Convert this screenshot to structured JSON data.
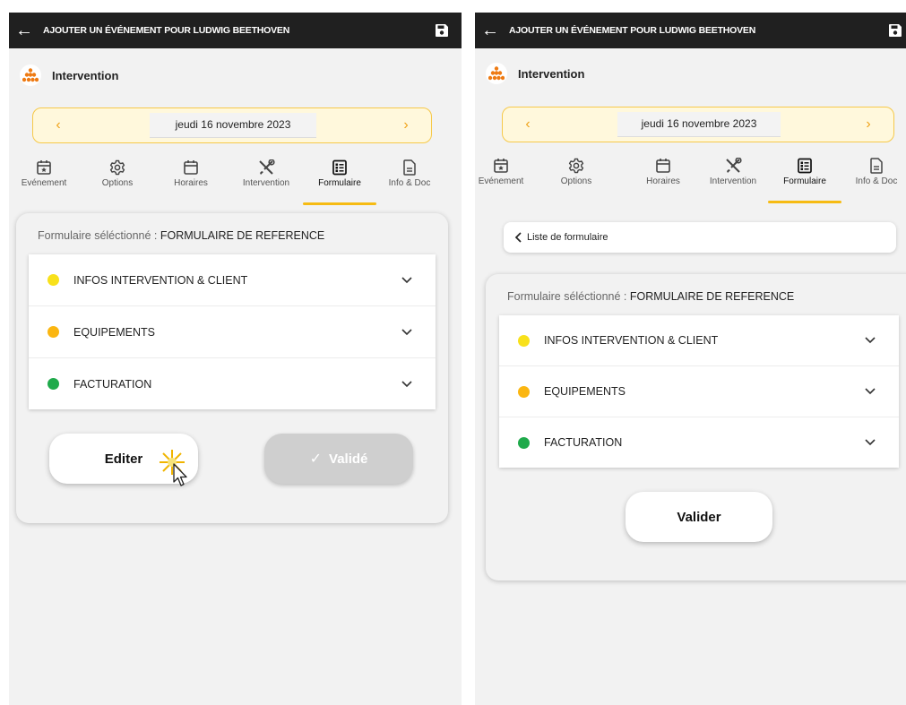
{
  "header": {
    "title": "AJOUTER UN ÉVÉNEMENT POUR LUDWIG BEETHOVEN"
  },
  "section": {
    "label": "Intervention"
  },
  "datebar": {
    "prev": "‹",
    "date": "jeudi 16 novembre 2023",
    "next": "›"
  },
  "tabs": [
    {
      "label": "Evénement",
      "icon": "calendar-star-icon"
    },
    {
      "label": "Options",
      "icon": "gear-icon"
    },
    {
      "label": "Horaires",
      "icon": "calendar-icon"
    },
    {
      "label": "Intervention",
      "icon": "tools-icon"
    },
    {
      "label": "Formulaire",
      "icon": "checklist-icon",
      "active": true
    },
    {
      "label": "Info & Doc",
      "icon": "document-icon"
    }
  ],
  "form": {
    "selected_prefix": "Formulaire séléctionné : ",
    "selected_value": "FORMULAIRE DE REFERENCE",
    "sections": [
      {
        "label": "INFOS INTERVENTION & CLIENT",
        "color": "#f8e11b"
      },
      {
        "label": "EQUIPEMENTS",
        "color": "#fbb611"
      },
      {
        "label": "FACTURATION",
        "color": "#1faa4b"
      }
    ]
  },
  "left": {
    "edit_label": "Editer",
    "validated_label": "Validé"
  },
  "right": {
    "list_label": "Liste de formulaire",
    "validate_label": "Valider"
  },
  "colors": {
    "accent": "#f6bb13",
    "topbar": "#202020"
  }
}
